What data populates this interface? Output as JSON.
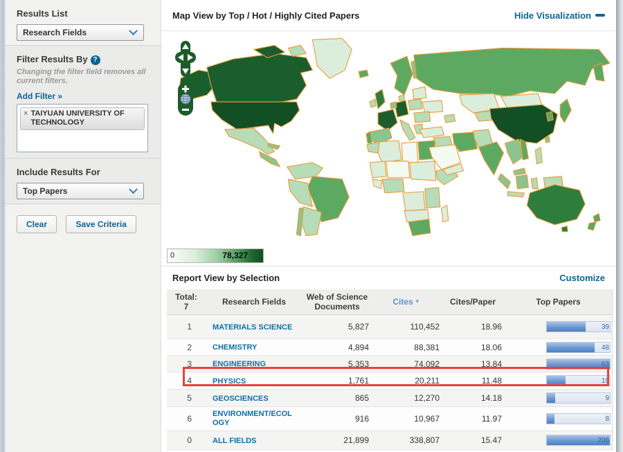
{
  "sidebar": {
    "results_list": {
      "label": "Results List",
      "value": "Research Fields"
    },
    "filter": {
      "title": "Filter Results By",
      "help_icon": "?",
      "note": "Changing the filter field removes all current filters.",
      "add_filter": "Add Filter »",
      "remove_icon": "×",
      "tag": "TAIYUAN UNIVERSITY OF TECHNOLOGY"
    },
    "include": {
      "label": "Include Results For",
      "value": "Top Papers"
    },
    "actions": {
      "clear": "Clear",
      "save": "Save Criteria"
    }
  },
  "map": {
    "title": "Map View by Top / Hot / Highly Cited Papers",
    "hide_visualization": "Hide Visualization",
    "legend": {
      "min": "0",
      "max": "78,327"
    },
    "controls": {
      "zoom_in": "+",
      "zoom_out": "−"
    },
    "colors": {
      "scale_low": "#f4faf3",
      "scale_high": "#14521f",
      "country_border": "#e89b38"
    }
  },
  "report": {
    "title": "Report View by Selection",
    "customize": "Customize",
    "total_label": "Total:",
    "total_value": "7",
    "columns": [
      "Research Fields",
      "Web of Science Documents",
      "Cites",
      "Cites/Paper",
      "Top Papers"
    ],
    "sorted_by": "Cites",
    "highlighted_row": "PHYSICS",
    "rows": [
      {
        "rank": "1",
        "field": "MATERIALS SCIENCE",
        "wos_documents": "5,827",
        "cites": "110,452",
        "cites_per_paper": "18.96",
        "top_papers": "39",
        "bar_pct": 62
      },
      {
        "rank": "2",
        "field": "CHEMISTRY",
        "wos_documents": "4,894",
        "cites": "88,381",
        "cites_per_paper": "18.06",
        "top_papers": "48",
        "bar_pct": 76
      },
      {
        "rank": "3",
        "field": "ENGINEERING",
        "wos_documents": "5,353",
        "cites": "74,092",
        "cites_per_paper": "13.84",
        "top_papers": "63",
        "bar_pct": 100
      },
      {
        "rank": "4",
        "field": "PHYSICS",
        "wos_documents": "1,761",
        "cites": "20,211",
        "cites_per_paper": "11.48",
        "top_papers": "19",
        "bar_pct": 30
      },
      {
        "rank": "5",
        "field": "GEOSCIENCES",
        "wos_documents": "865",
        "cites": "12,270",
        "cites_per_paper": "14.18",
        "top_papers": "9",
        "bar_pct": 13
      },
      {
        "rank": "6",
        "field": "ENVIRONMENT/ECOLOGY",
        "wos_documents": "916",
        "cites": "10,967",
        "cites_per_paper": "11.97",
        "top_papers": "8",
        "bar_pct": 12
      },
      {
        "rank": "0",
        "field": "ALL FIELDS",
        "wos_documents": "21,899",
        "cites": "338,807",
        "cites_per_paper": "15.47",
        "top_papers": "206",
        "bar_pct": 100
      }
    ]
  },
  "colors": {
    "link": "#0b6594",
    "highlight_box": "#e8413a",
    "bar_fill": "#5b8fd0"
  }
}
